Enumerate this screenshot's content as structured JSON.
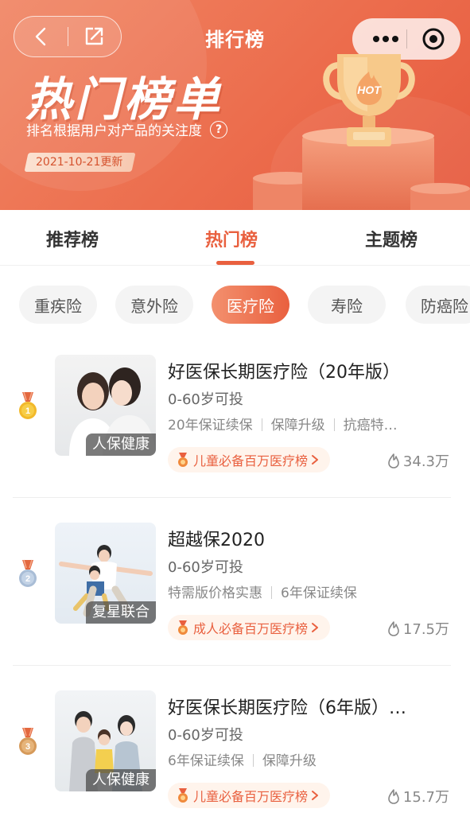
{
  "header": {
    "page_title": "排行榜",
    "hero_title": "热门榜单",
    "hero_subtitle": "排名根据用户对产品的关注度",
    "update_tag": "2021-10-21更新",
    "trophy_text": "HOT"
  },
  "tabs": [
    {
      "label": "推荐榜",
      "active": false
    },
    {
      "label": "热门榜",
      "active": true
    },
    {
      "label": "主题榜",
      "active": false
    }
  ],
  "chips": [
    {
      "label": "重疾险",
      "active": false
    },
    {
      "label": "意外险",
      "active": false
    },
    {
      "label": "医疗险",
      "active": true
    },
    {
      "label": "寿险",
      "active": false
    },
    {
      "label": "防癌险",
      "active": false
    }
  ],
  "products": [
    {
      "rank": "1",
      "name": "好医保长期医疗险（20年版）",
      "age": "0-60岁可投",
      "features": [
        "20年保证续保",
        "保障升级",
        "抗癌特…"
      ],
      "company": "人保健康",
      "tag": "儿童必备百万医疗榜",
      "heat": "34.3万"
    },
    {
      "rank": "2",
      "name": "超越保2020",
      "age": "0-60岁可投",
      "features": [
        "特需版价格实惠",
        "6年保证续保"
      ],
      "company": "复星联合",
      "tag": "成人必备百万医疗榜",
      "heat": "17.5万"
    },
    {
      "rank": "3",
      "name": "好医保长期医疗险（6年版）…",
      "age": "0-60岁可投",
      "features": [
        "6年保证续保",
        "保障升级"
      ],
      "company": "人保健康",
      "tag": "儿童必备百万医疗榜",
      "heat": "15.7万"
    }
  ],
  "colors": {
    "accent": "#e9603f",
    "header_bg": "#ec6d4d",
    "gold_medal": "#f2b92a",
    "silver_medal": "#a9bdd6",
    "bronze_medal": "#d69a5a"
  },
  "icons": {
    "back": "back-arrow-icon",
    "share": "share-icon",
    "more": "more-dots-icon",
    "close": "close-miniprogram-icon",
    "help": "help-question-icon",
    "heat": "flame-icon",
    "medal": "medal-icon",
    "chevron": "chevron-right-icon"
  }
}
